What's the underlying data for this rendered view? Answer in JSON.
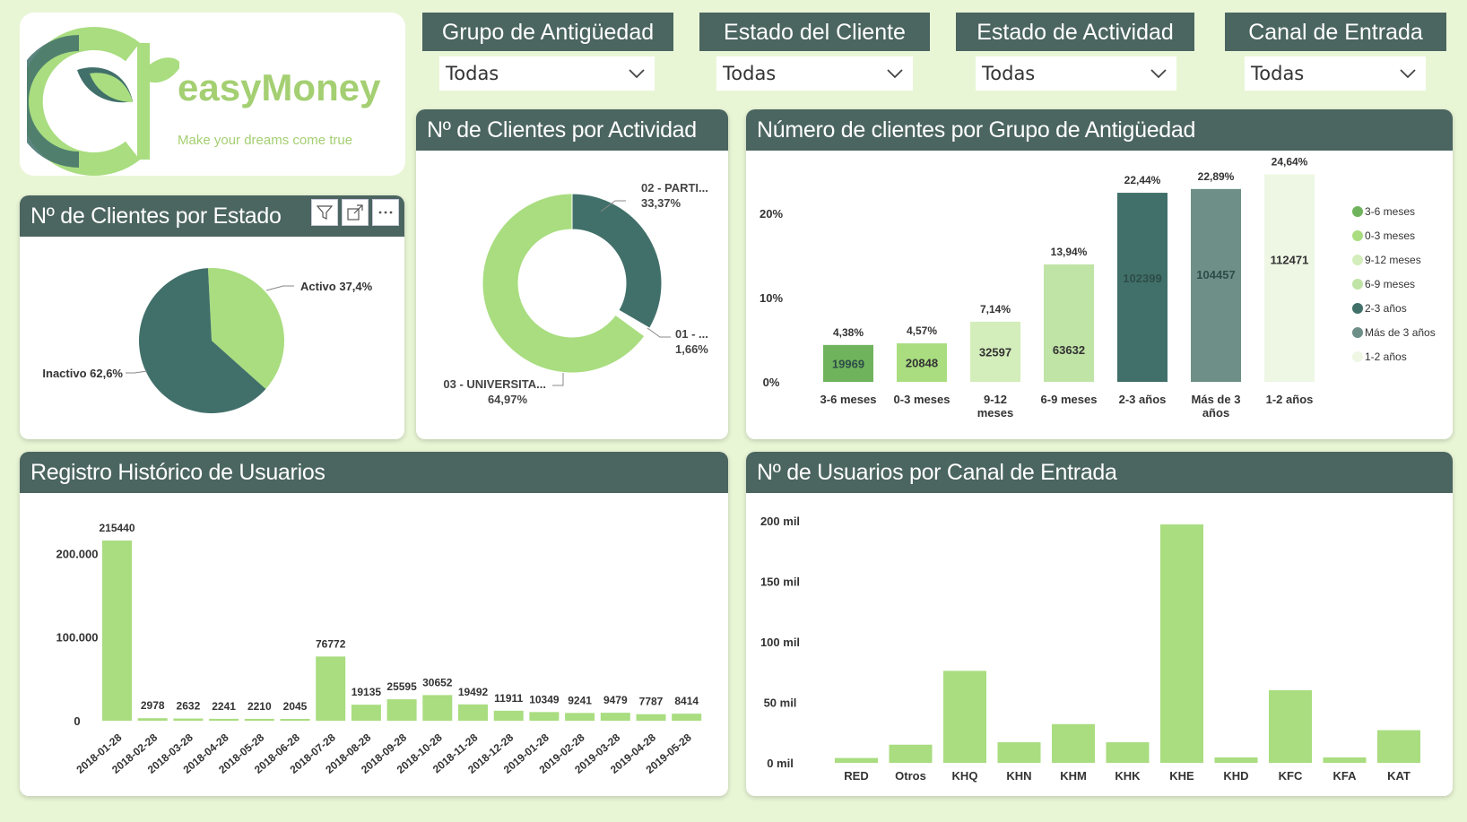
{
  "brand": {
    "name": "easyMoney",
    "tagline": "Make your dreams come true",
    "color": "#a4cf72"
  },
  "colors": {
    "header": "#4b6560",
    "background": "#e9f6d6",
    "light_green": "#b0e184",
    "dark_green": "#41706a"
  },
  "slicers": [
    {
      "title": "Grupo de Antigüedad",
      "value": "Todas"
    },
    {
      "title": "Estado del Cliente",
      "value": "Todas"
    },
    {
      "title": "Estado de Actividad",
      "value": "Todas"
    },
    {
      "title": "Canal de Entrada",
      "value": "Todas"
    }
  ],
  "visual_toolbar": [
    "filter-icon",
    "focus-mode-icon",
    "more-options-icon"
  ],
  "chart_data": [
    {
      "type": "pie",
      "title": "Nº de Clientes por Estado",
      "slices": [
        {
          "label": "Activo",
          "value": 37.4,
          "display": "Activo 37,4%",
          "color": "#a9dd80"
        },
        {
          "label": "Inactivo",
          "value": 62.6,
          "display": "Inactivo 62,6%",
          "color": "#41706a"
        }
      ]
    },
    {
      "type": "pie",
      "donut": true,
      "title": "Nº de Clientes por Actividad",
      "slices": [
        {
          "label": "02 - PARTI...",
          "value": 33.37,
          "pct": "33,37%",
          "color": "#41706a"
        },
        {
          "label": "01 - ...",
          "value": 1.66,
          "pct": "1,66%",
          "color": "#ffffff"
        },
        {
          "label": "03 - UNIVERSITA...",
          "value": 64.97,
          "pct": "64,97%",
          "color": "#a9dd80"
        }
      ]
    },
    {
      "type": "bar",
      "title": "Número de clientes por Grupo de Antigüedad",
      "categories": [
        "3-6 meses",
        "0-3 meses",
        "9-12 meses",
        "6-9 meses",
        "2-3 años",
        "Más de 3 años",
        "1-2 años"
      ],
      "values": [
        19969,
        20848,
        32597,
        63632,
        102399,
        104457,
        112471
      ],
      "percent_labels": [
        "4,38%",
        "4,57%",
        "7,14%",
        "13,94%",
        "22,44%",
        "22,89%",
        "24,64%"
      ],
      "percents": [
        4.38,
        4.57,
        7.14,
        13.94,
        22.44,
        22.89,
        24.64
      ],
      "colors": [
        "#6fb45c",
        "#a9dd80",
        "#d3edbb",
        "#c0e3a6",
        "#41706a",
        "#6e8f88",
        "#eef7e4"
      ],
      "yticks": [
        "0%",
        "10%",
        "20%"
      ],
      "ylim": [
        0,
        25
      ],
      "legend": [
        "3-6 meses",
        "0-3 meses",
        "9-12 meses",
        "6-9 meses",
        "2-3 años",
        "Más de 3 años",
        "1-2 años"
      ]
    },
    {
      "type": "bar",
      "title": "Registro Histórico de Usuarios",
      "categories": [
        "2018-01-28",
        "2018-02-28",
        "2018-03-28",
        "2018-04-28",
        "2018-05-28",
        "2018-06-28",
        "2018-07-28",
        "2018-08-28",
        "2018-09-28",
        "2018-10-28",
        "2018-11-28",
        "2018-12-28",
        "2019-01-28",
        "2019-02-28",
        "2019-03-28",
        "2019-04-28",
        "2019-05-28"
      ],
      "values": [
        215440,
        2978,
        2632,
        2241,
        2210,
        2045,
        76772,
        19135,
        25595,
        30652,
        19492,
        11911,
        10349,
        9241,
        9479,
        7787,
        8414
      ],
      "yticks": [
        "0",
        "100.000",
        "200.000"
      ],
      "ylim": [
        0,
        215440
      ],
      "color": "#a9dd80"
    },
    {
      "type": "bar",
      "title": "Nº de Usuarios por Canal de Entrada",
      "categories": [
        "RED",
        "Otros",
        "KHQ",
        "KHN",
        "KHM",
        "KHK",
        "KHE",
        "KHD",
        "KFC",
        "KFA",
        "KAT"
      ],
      "values": [
        4000,
        15000,
        76000,
        17000,
        32000,
        17000,
        197000,
        4500,
        60000,
        4500,
        27000
      ],
      "yticks": [
        "0 mil",
        "50 mil",
        "100 mil",
        "150 mil",
        "200 mil"
      ],
      "ylim": [
        0,
        200000
      ],
      "color": "#a9dd80"
    }
  ]
}
